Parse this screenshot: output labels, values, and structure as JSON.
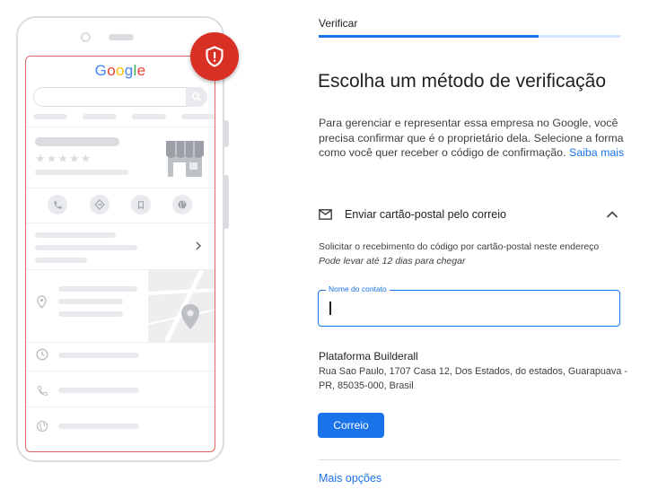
{
  "illustration": {
    "logo_text": "Google",
    "logo_letters": [
      {
        "ch": "G",
        "color": "#4285f4"
      },
      {
        "ch": "o",
        "color": "#ea4335"
      },
      {
        "ch": "o",
        "color": "#fbbc05"
      },
      {
        "ch": "g",
        "color": "#4285f4"
      },
      {
        "ch": "l",
        "color": "#34a853"
      },
      {
        "ch": "e",
        "color": "#ea4335"
      }
    ],
    "stars": "★★★★★",
    "badge_icon": "shield-alert-icon",
    "badge_color": "#d93025"
  },
  "step": {
    "label": "Verificar",
    "progress": 0.73
  },
  "title": "Escolha um método de verificação",
  "description": {
    "text": "Para gerenciar e representar essa empresa no Google, você precisa confirmar que é o proprietário dela. Selecione a forma como você quer receber o código de confirmação.",
    "link": "Saiba mais"
  },
  "method": {
    "icon": "mail-icon",
    "label": "Enviar cartão-postal pelo correio",
    "expand_icon": "chevron-up-icon",
    "request_text": "Solicitar o recebimento do código por cartão-postal neste endereço",
    "eta_text": "Pode levar até 12 dias para chegar"
  },
  "contact_field": {
    "label": "Nome do contato",
    "value": ""
  },
  "business": {
    "name": "Plataforma Builderall",
    "address": "Rua Sao Paulo, 1707 Casa 12, Dos Estados, do estados, Guarapuava - PR, 85035-000, Brasil"
  },
  "submit_label": "Correio",
  "more_options": "Mais opções",
  "colors": {
    "accent": "#1a73e8",
    "alert": "#d93025"
  }
}
